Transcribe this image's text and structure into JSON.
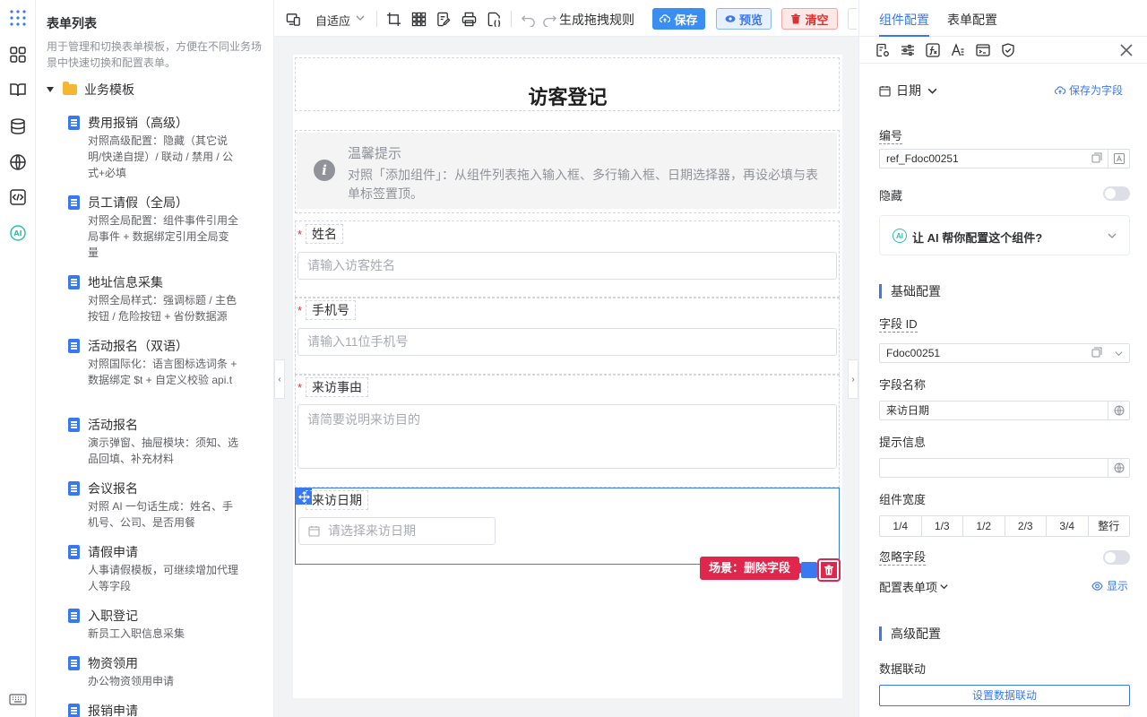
{
  "colors": {
    "accent": "#3a78f2",
    "danger": "#e0264a",
    "save": "#3a8ef2"
  },
  "rail": {
    "icons": [
      "app-grid-icon",
      "components-icon",
      "book-icon",
      "database-icon",
      "globe-icon",
      "code-icon",
      "ai-icon",
      "keyboard-icon"
    ],
    "ai_label": "AI"
  },
  "templates": {
    "title": "表单列表",
    "description": "用于管理和切换表单模板，方便在不同业务场景中快速切换和配置表单。",
    "folder": "业务模板",
    "items": [
      {
        "name": "费用报销（高级）",
        "sub": "对照高级配置：隐藏（其它说明/快递自提）/ 联动 / 禁用 / 公式+必填"
      },
      {
        "name": "员工请假（全局）",
        "sub": "对照全局配置：组件事件引用全局事件 + 数据绑定引用全局变量"
      },
      {
        "name": "地址信息采集",
        "sub": "对照全局样式：强调标题 / 主色按钮 / 危险按钮 + 省份数据源"
      },
      {
        "name": "活动报名（双语）",
        "sub": "对照国际化：语言图标选词条 + 数据绑定 $t + 自定义校验 api.t"
      },
      {
        "name": "活动报名",
        "sub": "演示弹窗、抽屉模块：须知、选品回填、补充材料"
      },
      {
        "name": "会议报名",
        "sub": "对照 AI 一句话生成：姓名、手机号、公司、是否用餐"
      },
      {
        "name": "请假申请",
        "sub": "人事请假模板，可继续增加代理人等字段"
      },
      {
        "name": "入职登记",
        "sub": "新员工入职信息采集"
      },
      {
        "name": "物资领用",
        "sub": "办公物资领用申请"
      },
      {
        "name": "报销申请",
        "sub": ""
      }
    ]
  },
  "toolbar": {
    "layout_mode": "自适应",
    "generate_rules": "生成拖拽规则",
    "save": "保存",
    "preview": "预览",
    "clear": "清空"
  },
  "form": {
    "title": "访客登记",
    "tip_title": "温馨提示",
    "tip_text": "对照「添加组件」：从组件列表拖入输入框、多行输入框、日期选择器，再设必填与表单标签置顶。",
    "fields": [
      {
        "label": "姓名",
        "required": "*",
        "placeholder": "请输入访客姓名"
      },
      {
        "label": "手机号",
        "required": "*",
        "placeholder": "请输入11位手机号"
      },
      {
        "label": "来访事由",
        "required": "*",
        "placeholder": "请简要说明来访目的"
      }
    ],
    "date_field": {
      "label": "来访日期",
      "placeholder": "请选择来访日期"
    },
    "scene_badge": "场景：删除字段"
  },
  "panel": {
    "tabs": [
      "组件配置",
      "表单配置"
    ],
    "component_type": "日期",
    "save_as_field": "保存为字段",
    "ref_label": "编号",
    "ref_value": "ref_Fdoc00251",
    "hidden_label": "隐藏",
    "ai_prompt": "让 AI 帮你配置这个组件?",
    "basic_section": "基础配置",
    "field_id_label": "字段 ID",
    "field_id_value": "Fdoc00251",
    "field_name_label": "字段名称",
    "field_name_value": "来访日期",
    "hint_label": "提示信息",
    "hint_value": "",
    "width_label": "组件宽度",
    "width_options": [
      "1/4",
      "1/3",
      "1/2",
      "2/3",
      "3/4",
      "整行"
    ],
    "ignore_label": "忽略字段",
    "form_item_label": "配置表单项",
    "show_label": "显示",
    "advanced_section": "高级配置",
    "linkage_label": "数据联动",
    "linkage_button": "设置数据联动"
  }
}
